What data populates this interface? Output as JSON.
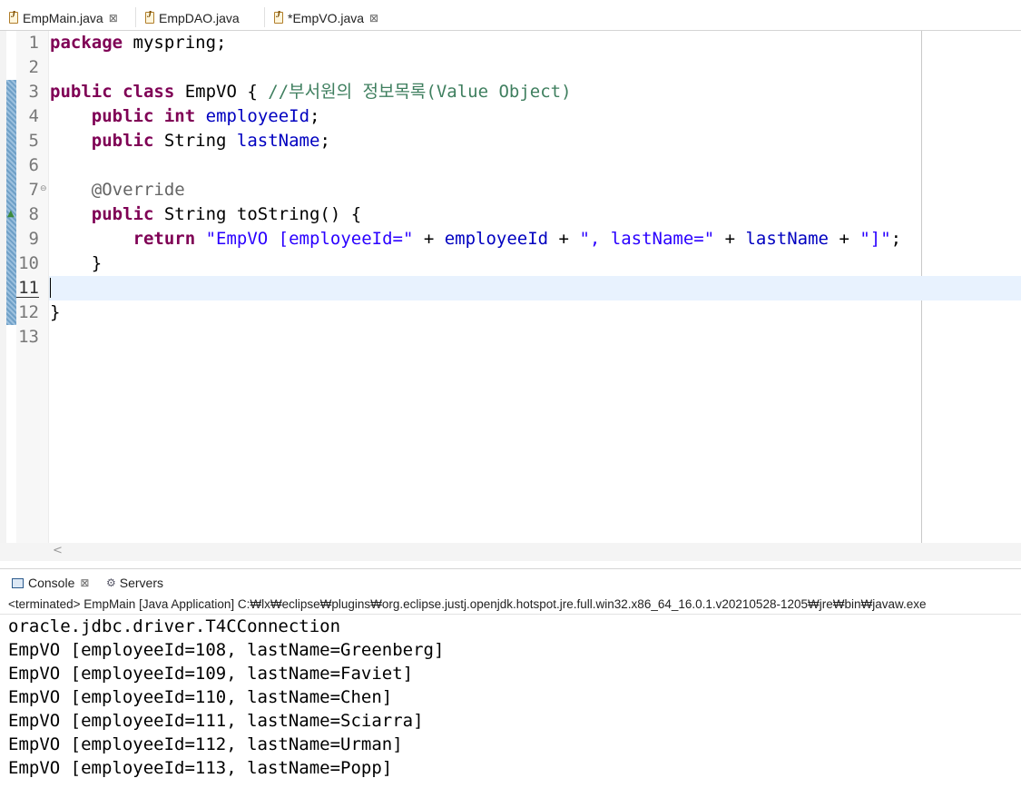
{
  "editor_tabs": [
    {
      "label": "EmpMain.java",
      "close": "⊠",
      "active": false
    },
    {
      "label": "EmpDAO.java",
      "active": false
    },
    {
      "label": "*EmpVO.java",
      "close": "⊠",
      "active": true
    }
  ],
  "code_lines": [
    {
      "num": "1"
    },
    {
      "num": "2"
    },
    {
      "num": "3"
    },
    {
      "num": "4"
    },
    {
      "num": "5"
    },
    {
      "num": "6"
    },
    {
      "num": "7"
    },
    {
      "num": "8"
    },
    {
      "num": "9"
    },
    {
      "num": "10"
    },
    {
      "num": "11"
    },
    {
      "num": "12"
    },
    {
      "num": "13"
    }
  ],
  "code": {
    "l1_kw": "package",
    "l1_rest": " myspring;",
    "l3_kw1": "public",
    "l3_kw2": "class",
    "l3_rest": " EmpVO { ",
    "l3_comment": "//부서원의 정보목록(Value Object)",
    "l4_kw1": "public",
    "l4_kw2": "int",
    "l4_field": "employeeId",
    "l4_end": ";",
    "l5_kw1": "public",
    "l5_type": " String ",
    "l5_field": "lastName",
    "l5_end": ";",
    "l7_ann": "@Override",
    "l8_kw1": "public",
    "l8_rest": " String toString() {",
    "l9_kw": "return",
    "l9_s1": "\"EmpVO [employeeId=\"",
    "l9_p1": " + ",
    "l9_f1": "employeeId",
    "l9_p2": " + ",
    "l9_s2": "\", lastName=\"",
    "l9_p3": " + ",
    "l9_f2": "lastName",
    "l9_p4": " + ",
    "l9_s3": "\"]\"",
    "l9_end": ";",
    "l10": "}",
    "l12": "}"
  },
  "console": {
    "tab_label": "Console",
    "tab_close": "⊠",
    "servers_label": "Servers",
    "status": "<terminated> EmpMain [Java Application] C:₩lx₩eclipse₩plugins₩org.eclipse.justj.openjdk.hotspot.jre.full.win32.x86_64_16.0.1.v20210528-1205₩jre₩bin₩javaw.exe",
    "output": [
      "oracle.jdbc.driver.T4CConnection",
      "EmpVO [employeeId=108, lastName=Greenberg]",
      "EmpVO [employeeId=109, lastName=Faviet]",
      "EmpVO [employeeId=110, lastName=Chen]",
      "EmpVO [employeeId=111, lastName=Sciarra]",
      "EmpVO [employeeId=112, lastName=Urman]",
      "EmpVO [employeeId=113, lastName=Popp]"
    ]
  }
}
